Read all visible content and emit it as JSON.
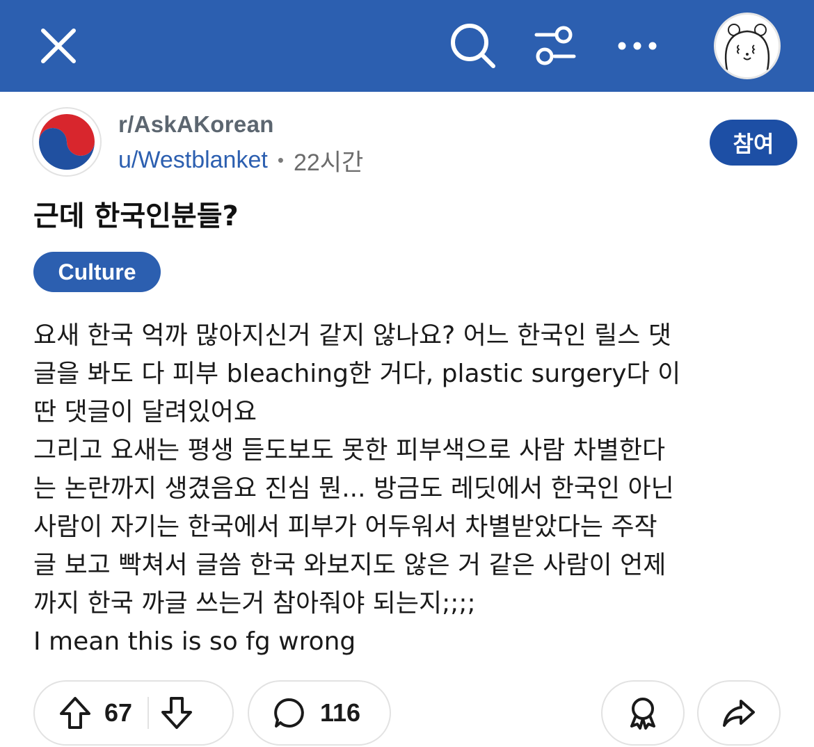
{
  "topbar": {
    "background": "#2c5fb0",
    "icons": [
      "close-icon",
      "search-icon",
      "filter-icon",
      "more-icon"
    ],
    "avatar_icon": "bear-avatar-icon"
  },
  "post": {
    "subreddit": "r/AskAKorean",
    "username": "u/Westblanket",
    "separator": "•",
    "time": "22시간",
    "join_label": "참여",
    "title": "근데 한국인분들?",
    "flair": "Culture",
    "body_lines": [
      "요새 한국 억까 많아지신거 같지 않나요? 어느 한국인 릴스 댓",
      "글을 봐도 다 피부 bleaching한 거다, plastic surgery다 이",
      "딴 댓글이 달려있어요",
      "그리고 요새는 평생 듣도보도 못한 피부색으로 사람 차별한다",
      "는 논란까지 생겼음요 진심 뭔... 방금도 레딧에서 한국인 아닌",
      "사람이 자기는 한국에서 피부가 어두워서 차별받았다는 주작",
      "글 보고 빡쳐서 글씀 한국 와보지도 않은 거 같은 사람이 언제",
      "까지 한국 까글 쓰는거 참아줘야 되는지;;;;",
      "I mean this is so fg wrong"
    ]
  },
  "actions": {
    "upvotes": "67",
    "comments": "116",
    "icons": [
      "upvote-icon",
      "downvote-icon",
      "comment-icon",
      "award-icon",
      "share-icon"
    ]
  },
  "colors": {
    "accent": "#2c5fb0",
    "join_button": "#1d4fa5",
    "flag_red": "#d8262d",
    "flag_blue": "#2050a0"
  }
}
